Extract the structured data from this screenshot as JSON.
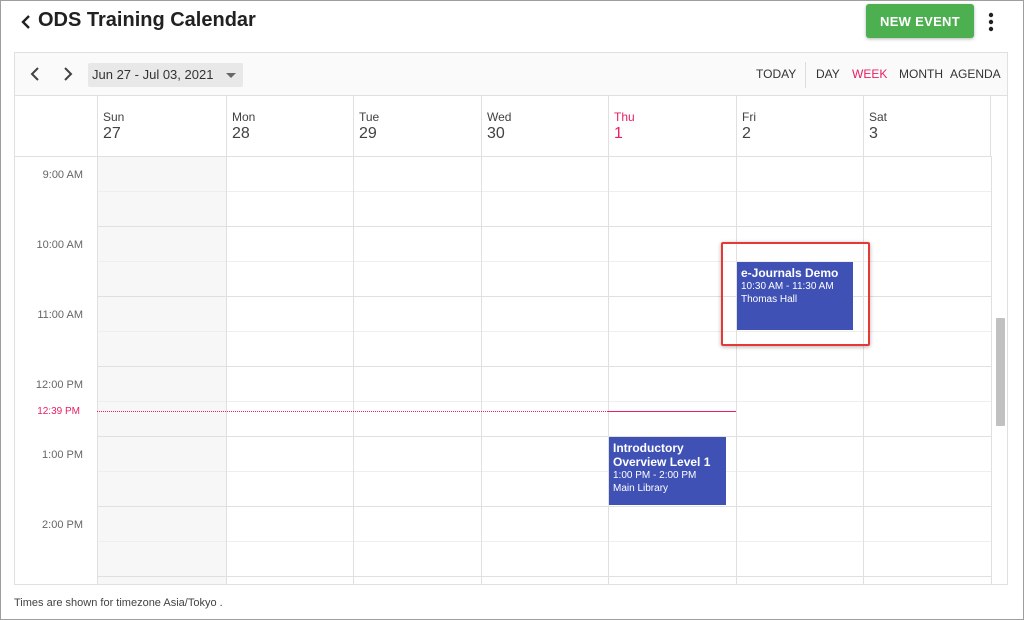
{
  "header": {
    "title": "ODS Training Calendar",
    "new_event_label": "NEW EVENT"
  },
  "toolbar": {
    "date_range": "Jun 27 - Jul 03, 2021",
    "today_label": "TODAY",
    "views": [
      "DAY",
      "WEEK",
      "MONTH",
      "AGENDA"
    ],
    "active_view": "WEEK"
  },
  "days": [
    {
      "name": "Sun",
      "num": "27"
    },
    {
      "name": "Mon",
      "num": "28"
    },
    {
      "name": "Tue",
      "num": "29"
    },
    {
      "name": "Wed",
      "num": "30"
    },
    {
      "name": "Thu",
      "num": "1"
    },
    {
      "name": "Fri",
      "num": "2"
    },
    {
      "name": "Sat",
      "num": "3"
    }
  ],
  "times": [
    "9:00 AM",
    "10:00 AM",
    "11:00 AM",
    "12:00 PM",
    "1:00 PM",
    "2:00 PM"
  ],
  "now_label": "12:39 PM",
  "events": [
    {
      "title": "e-Journals Demo",
      "time": "10:30 AM - 11:30 AM",
      "location": "Thomas Hall"
    },
    {
      "title": "Introductory Overview Level 1",
      "time": "1:00 PM - 2:00 PM",
      "location": "Main Library"
    }
  ],
  "footer": "Times are shown for timezone Asia/Tokyo .",
  "colors": {
    "accent": "#e91e63",
    "event": "#3f51b5",
    "new_event": "#4caf50",
    "highlight": "#e53935"
  }
}
